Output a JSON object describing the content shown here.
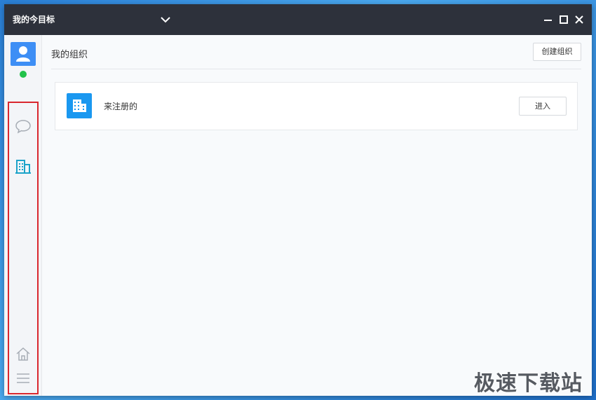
{
  "window": {
    "title": "我的今目标"
  },
  "page": {
    "title": "我的组织",
    "create_button": "创建组织"
  },
  "organizations": [
    {
      "name": "来注册的",
      "enter_button": "进入"
    }
  ],
  "sidebar": {
    "status": "online",
    "items": [
      {
        "icon": "chat-bubble-icon",
        "active": false
      },
      {
        "icon": "building-icon",
        "active": true
      },
      {
        "icon": "home-icon",
        "active": false
      },
      {
        "icon": "menu-icon",
        "active": false
      }
    ]
  },
  "watermark": "极速下载站",
  "colors": {
    "titlebar": "#2d313b",
    "accent": "#3d8ef5",
    "active_nav": "#1ba3c9",
    "status_online": "#21c24a",
    "highlight_box": "#d9272e"
  }
}
